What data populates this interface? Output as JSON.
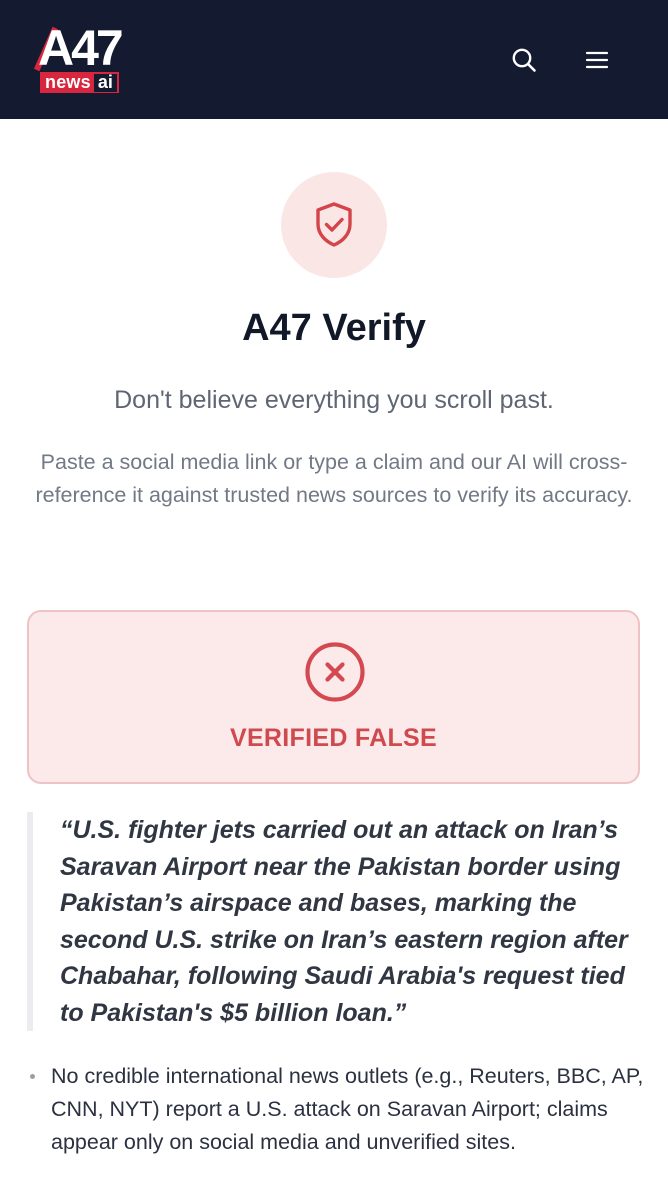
{
  "header": {
    "logo_main": "A47",
    "logo_news": "news",
    "logo_ai": "ai",
    "search_icon": "search-icon",
    "menu_icon": "hamburger-menu-icon",
    "bg_color": "#141a30",
    "accent_color": "#d7263d"
  },
  "hero": {
    "icon": "shield-check-icon",
    "title": "A47 Verify",
    "subtitle": "Don't believe everything you scroll past.",
    "description": "Paste a social media link or type a claim and our AI will cross-reference it against trusted news sources to verify its accuracy."
  },
  "result": {
    "icon": "x-circle-icon",
    "verdict": "VERIFIED FALSE",
    "verdict_color": "#cf4a4f",
    "card_bg": "#fce9ea",
    "claim": "“U.S. fighter jets carried out an attack on Iran’s Saravan Airport near the Pakistan border using Pakistan’s airspace and bases, marking the second U.S. strike on Iran’s eastern region after Chabahar, following Saudi Arabia's request tied to Pakistan's $5 billion loan.”",
    "findings": [
      {
        "text": "No credible international news outlets (e.g., Reuters, BBC, AP, CNN, NYT) report a U.S. attack on Saravan Airport; claims appear only on social media and unverified sites."
      }
    ]
  }
}
